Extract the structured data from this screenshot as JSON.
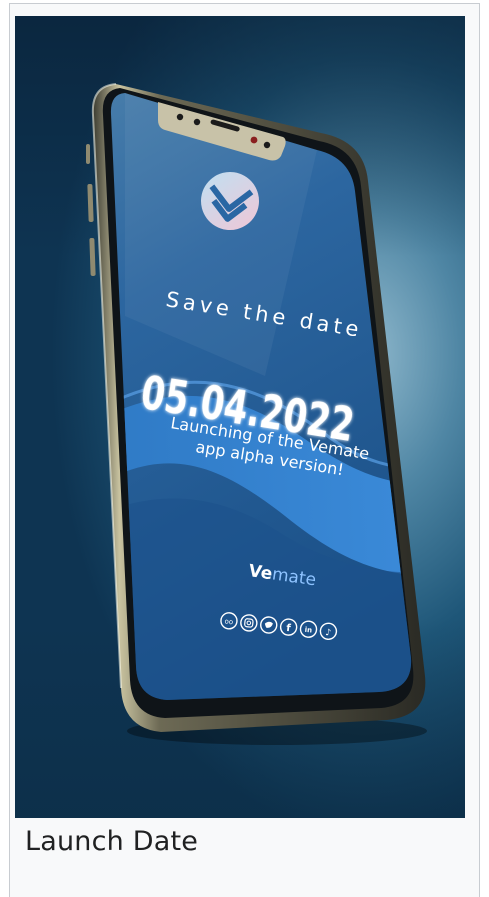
{
  "caption": "Launch Date",
  "poster": {
    "headline": "Save the date",
    "date": "05.04.2022",
    "message_line1": "Launching of the Vemate",
    "message_line2": "app alpha version!",
    "brand_bold": "Ve",
    "brand_light": "mate"
  },
  "social_icons": [
    "discord-icon",
    "instagram-icon",
    "twitter-icon",
    "facebook-icon",
    "linkedin-icon",
    "tiktok-icon"
  ],
  "social_glyphs": {
    "discord": "oo",
    "facebook": "f",
    "linkedin": "in",
    "tiktok": "♪"
  },
  "colors": {
    "background_deep": "#0e3452",
    "background_glow": "#8fb8cc",
    "screen_blue": "#1f5d96",
    "wave_blue": "#2f7bc7",
    "logo_pink": "#e6c8d4",
    "text_white": "#ffffff",
    "brand_light": "#8ec3ff"
  }
}
